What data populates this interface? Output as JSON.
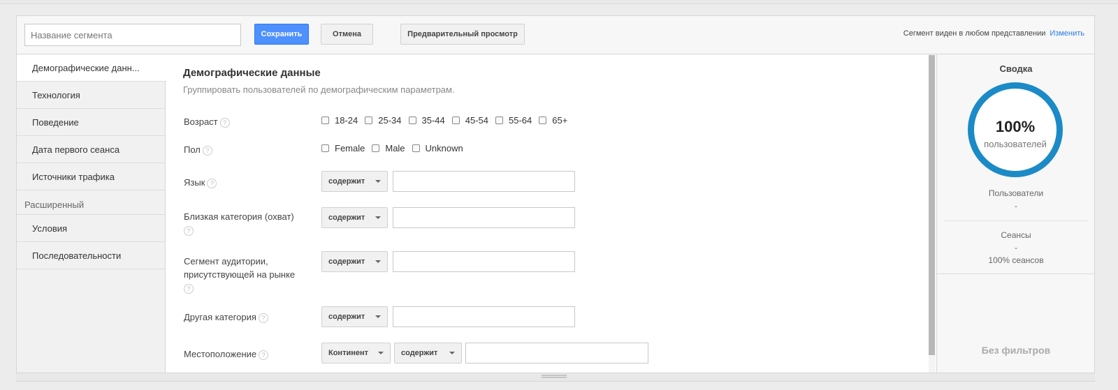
{
  "toolbar": {
    "segment_name_placeholder": "Название сегмента",
    "save_label": "Сохранить",
    "cancel_label": "Отмена",
    "preview_label": "Предварительный просмотр",
    "visibility_text": "Сегмент виден в любом представлении",
    "change_link": "Изменить"
  },
  "sidebar": {
    "items": [
      {
        "label": "Демографические данн..."
      },
      {
        "label": "Технология"
      },
      {
        "label": "Поведение"
      },
      {
        "label": "Дата первого сеанса"
      },
      {
        "label": "Источники трафика"
      }
    ],
    "advanced_section": "Расширенный",
    "advanced_items": [
      {
        "label": "Условия"
      },
      {
        "label": "Последовательности"
      }
    ]
  },
  "main": {
    "title": "Демографические данные",
    "subtitle": "Группировать пользователей по демографическим параметрам.",
    "help_glyph": "?",
    "age": {
      "label": "Возраст",
      "options": [
        "18-24",
        "25-34",
        "35-44",
        "45-54",
        "55-64",
        "65+"
      ]
    },
    "gender": {
      "label": "Пол",
      "options": [
        "Female",
        "Male",
        "Unknown"
      ]
    },
    "language": {
      "label": "Язык",
      "operator": "содержит"
    },
    "affinity": {
      "label": "Близкая категория (охват)",
      "operator": "содержит"
    },
    "in_market": {
      "label_line1": "Сегмент аудитории,",
      "label_line2": "присутствующей на рынке",
      "operator": "содержит"
    },
    "other_category": {
      "label": "Другая категория",
      "operator": "содержит"
    },
    "location": {
      "label": "Местоположение",
      "scope": "Континент",
      "operator": "содержит"
    }
  },
  "summary": {
    "title": "Сводка",
    "percent": "100%",
    "percent_label": "пользователей",
    "users_label": "Пользователи",
    "users_value": "-",
    "sessions_label": "Сеансы",
    "sessions_value": "-",
    "sessions_pct": "100% сеансов",
    "no_filters": "Без фильтров"
  },
  "colors": {
    "accent": "#4d90fe",
    "ring": "#1b8ac7",
    "link": "#2a7ae2"
  }
}
